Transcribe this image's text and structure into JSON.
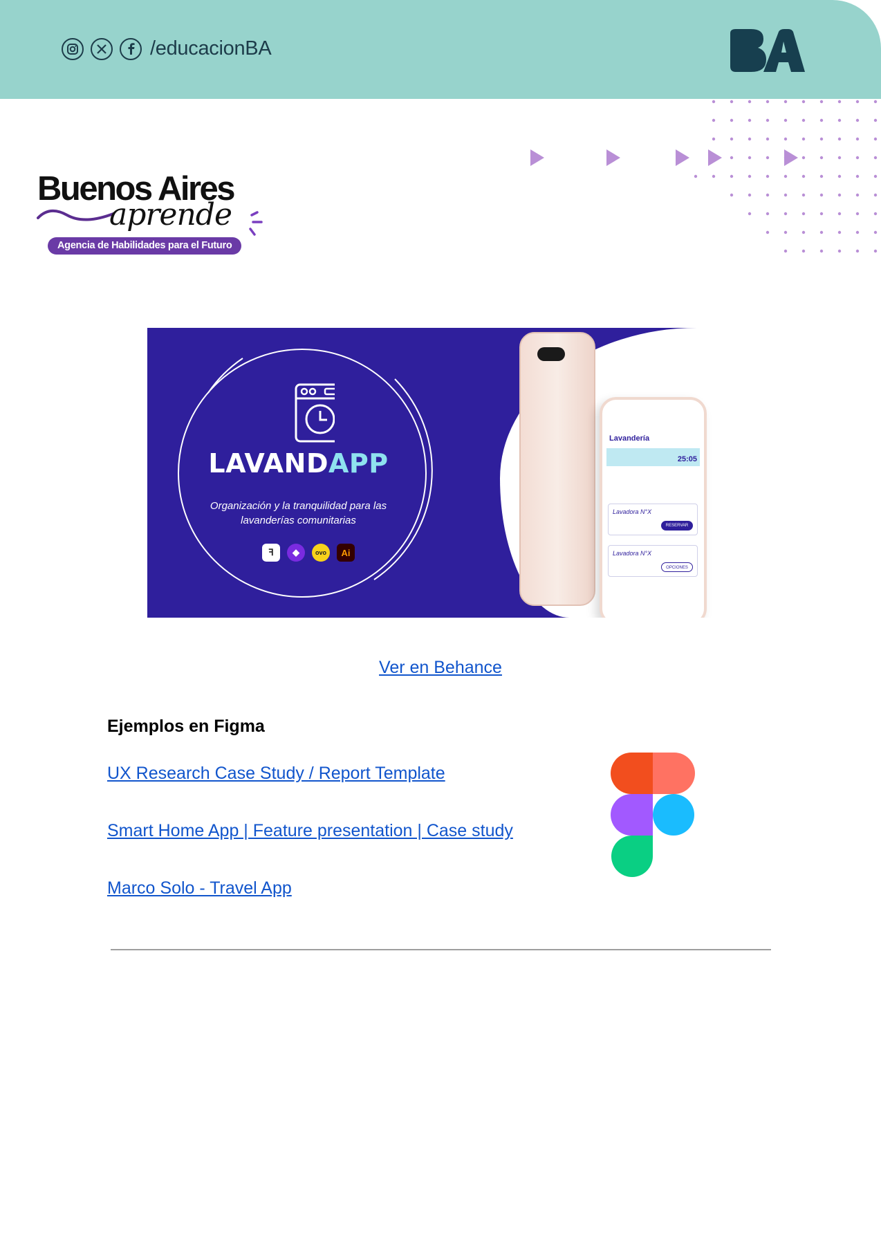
{
  "header": {
    "social_icons": [
      "instagram-icon",
      "x-icon",
      "facebook-icon"
    ],
    "handle": "/educacionBA",
    "logo_text": "BA",
    "background_color": "#97d3cc"
  },
  "brand": {
    "title": "Buenos Aires",
    "script": "aprende",
    "tagline": "Agencia de Habilidades para el Futuro"
  },
  "banner": {
    "app_name_part1": "LAVAND",
    "app_name_part2": "APP",
    "tagline_line1": "Organización y la tranquilidad para las",
    "tagline_line2": "lavanderías comunitarias",
    "tools": [
      "figma-icon",
      "framer-icon",
      "overflow-icon",
      "illustrator-icon"
    ],
    "phone": {
      "title": "Lavandería",
      "timer": "25:05",
      "cards": [
        "Lavadora N°X",
        "Lavadora N°X"
      ],
      "reserve_button": "RESERVAR",
      "options_button": "OPCIONES"
    }
  },
  "behance_link": "Ver en Behance",
  "figma_section": {
    "title": "Ejemplos en Figma",
    "links": [
      "UX Research Case Study / Report Template",
      "Smart Home App | Feature presentation | Case study",
      "Marco Solo - Travel App"
    ]
  }
}
